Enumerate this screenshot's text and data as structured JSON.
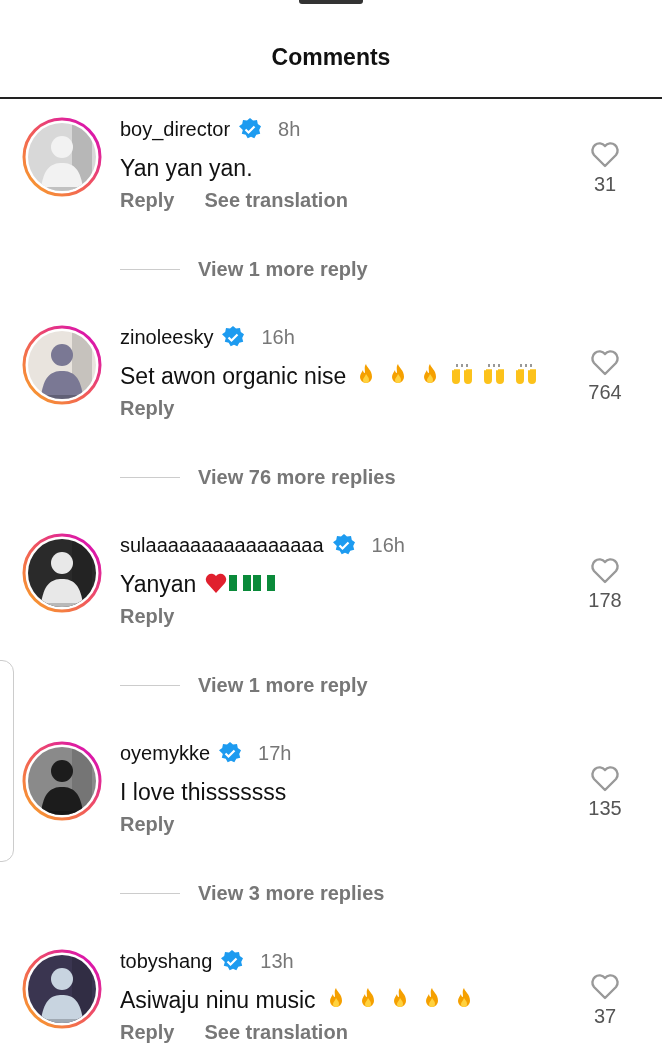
{
  "header": {
    "title": "Comments"
  },
  "comments": [
    {
      "username": "boy_director",
      "verified": true,
      "time": "8h",
      "text": "Yan yan yan.",
      "likes": "31",
      "actions": [
        "Reply",
        "See translation"
      ],
      "more_replies": "View 1 more reply",
      "avatar": {
        "kind": "picture"
      }
    },
    {
      "username": "zinoleesky",
      "verified": true,
      "time": "16h",
      "text": "Set awon organic nise",
      "emoji": [
        {
          "kind": "fire"
        },
        {
          "kind": "fire"
        },
        {
          "kind": "fire"
        },
        {
          "kind": "raised-hands"
        },
        {
          "kind": "raised-hands"
        },
        {
          "kind": "raised-hands"
        }
      ],
      "likes": "764",
      "actions": [
        "Reply"
      ],
      "more_replies": "View 76 more replies",
      "avatar": {
        "kind": "picture"
      }
    },
    {
      "username": "sulaaaaaaaaaaaaaaaa",
      "verified": true,
      "time": "16h",
      "text": "Yanyan",
      "emoji": [
        {
          "kind": "heart"
        },
        {
          "kind": "flag"
        },
        {
          "kind": "flag"
        }
      ],
      "likes": "178",
      "actions": [
        "Reply"
      ],
      "more_replies": "View 1 more reply",
      "avatar": {
        "kind": "picture"
      }
    },
    {
      "username": "oyemykke",
      "verified": true,
      "time": "17h",
      "text": "I love thisssssss",
      "likes": "135",
      "actions": [
        "Reply"
      ],
      "more_replies": "View 3 more replies",
      "avatar": {
        "kind": "picture"
      }
    },
    {
      "username": "tobyshang",
      "verified": true,
      "time": "13h",
      "text": "Asiwaju ninu music",
      "emoji": [
        {
          "kind": "fire"
        },
        {
          "kind": "fire"
        },
        {
          "kind": "fire"
        },
        {
          "kind": "fire"
        },
        {
          "kind": "fire"
        }
      ],
      "likes": "37",
      "actions": [
        "Reply",
        "See translation"
      ],
      "avatar": {
        "kind": "picture"
      }
    }
  ]
}
